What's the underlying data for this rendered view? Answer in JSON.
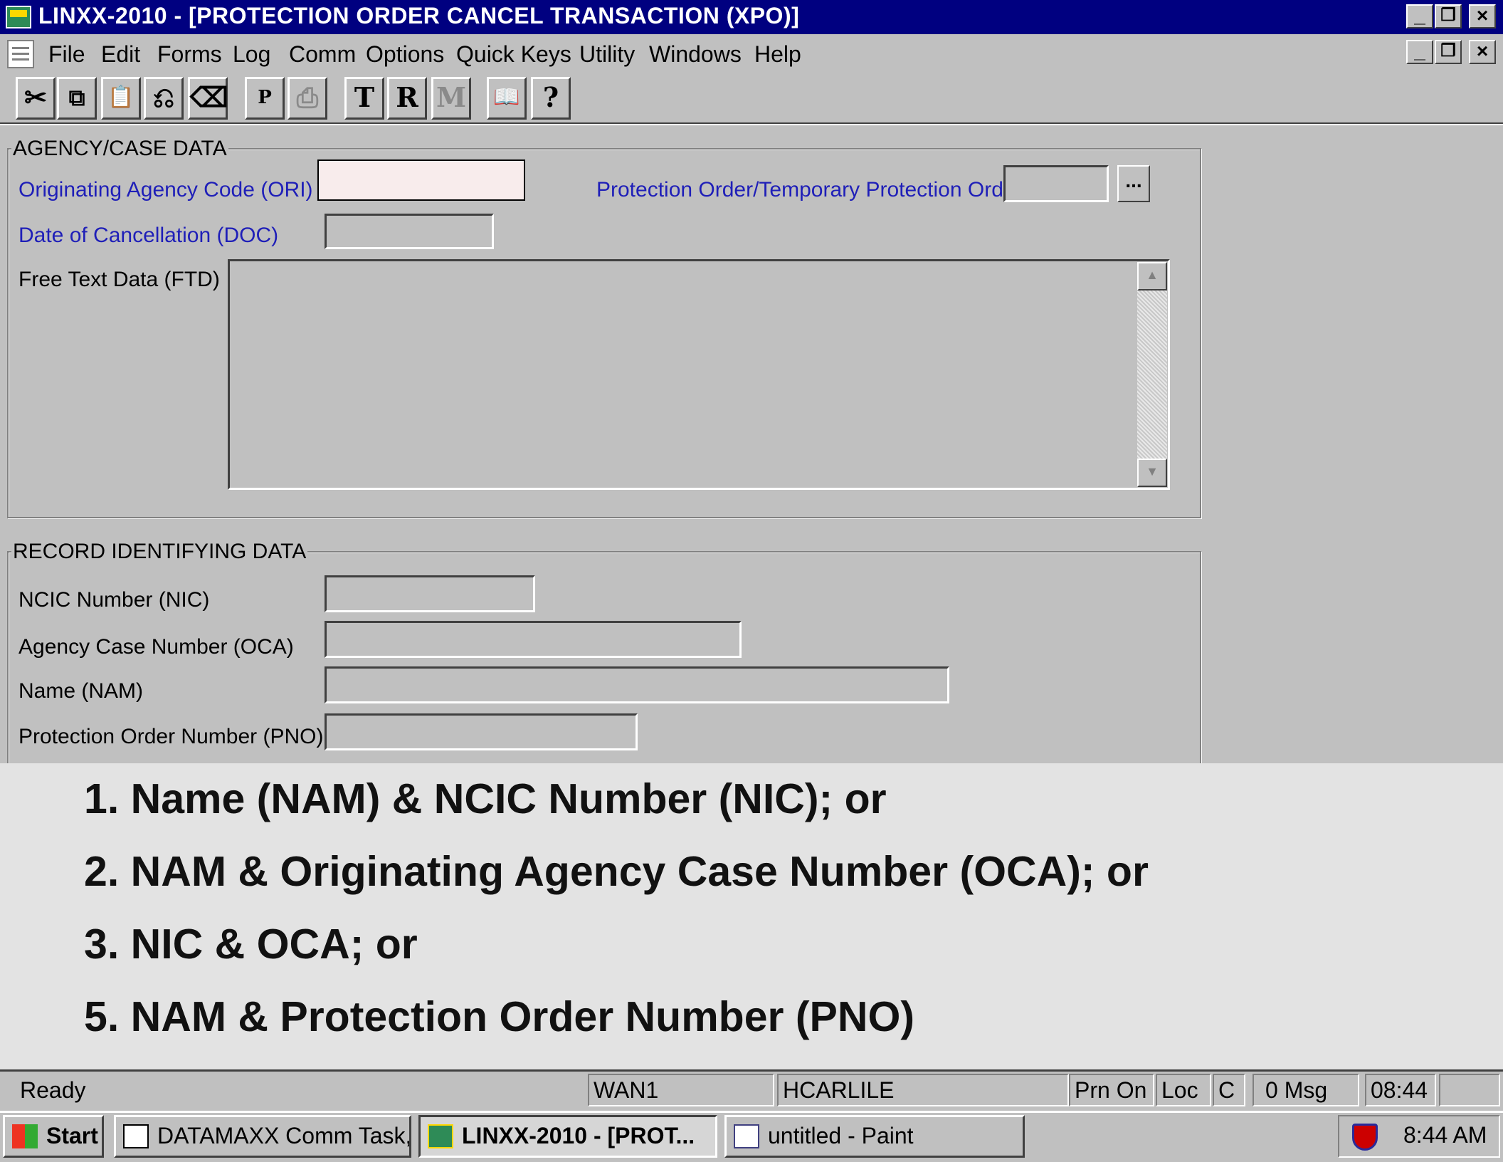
{
  "window": {
    "title": "LINXX-2010 - [PROTECTION ORDER CANCEL TRANSACTION (XPO)]",
    "caption_buttons": [
      "minimize-icon",
      "restore-icon",
      "close-icon"
    ]
  },
  "menu": {
    "items": [
      "File",
      "Edit",
      "Forms",
      "Log",
      "Comm",
      "Options",
      "Quick Keys",
      "Utility",
      "Windows",
      "Help"
    ]
  },
  "toolbar": {
    "buttons": [
      {
        "icon": "cut-icon",
        "glyph": "✂"
      },
      {
        "icon": "copy-icon",
        "glyph": "⧉"
      },
      {
        "icon": "paste-icon",
        "glyph": "📋"
      },
      {
        "icon": "undo-icon",
        "glyph": "⎌"
      },
      {
        "icon": "eraser-icon",
        "glyph": "⌫"
      },
      {
        "icon": "print-preview-icon",
        "glyph": "P"
      },
      {
        "icon": "print-icon",
        "glyph": "⎙"
      },
      {
        "icon": "t-icon",
        "glyph": "T"
      },
      {
        "icon": "r-icon",
        "glyph": "R"
      },
      {
        "icon": "m-icon",
        "glyph": "M"
      },
      {
        "icon": "book-icon",
        "glyph": "📖"
      },
      {
        "icon": "help-icon",
        "glyph": "?"
      }
    ]
  },
  "agency": {
    "group_label": "AGENCY/CASE DATA",
    "ori_label": "Originating Agency Code (ORI)",
    "ori_value": "",
    "po_label": "Protection Order/Temporary Protection Order",
    "po_value": "",
    "po_button": "...",
    "doc_label": "Date of Cancellation (DOC)",
    "doc_value": "",
    "ftd_label": "Free Text Data (FTD)",
    "ftd_value": ""
  },
  "record": {
    "group_label": "RECORD IDENTIFYING DATA",
    "nic_label": "NCIC Number (NIC)",
    "oca_label": "Agency Case Number (OCA)",
    "nam_label": "Name (NAM)",
    "pno_label": "Protection Order Number (PNO)"
  },
  "overlay": {
    "lines": [
      "1. Name (NAM) & NCIC Number (NIC); or",
      "2. NAM & Originating Agency Case Number (OCA); or",
      "3. NIC & OCA; or",
      "5. NAM & Protection Order Number (PNO)"
    ]
  },
  "status": {
    "ready": "Ready",
    "line": "WAN1",
    "user": "HCARLILE",
    "prn": "Prn On",
    "loc": "Loc",
    "c": "C",
    "msg": "0 Msg",
    "time": "08:44"
  },
  "taskbar": {
    "start": "Start",
    "tasks": [
      "DATAMAXX Comm Task, ...",
      "LINXX-2010 - [PROT...",
      "untitled - Paint"
    ],
    "clock": "8:44 AM"
  }
}
